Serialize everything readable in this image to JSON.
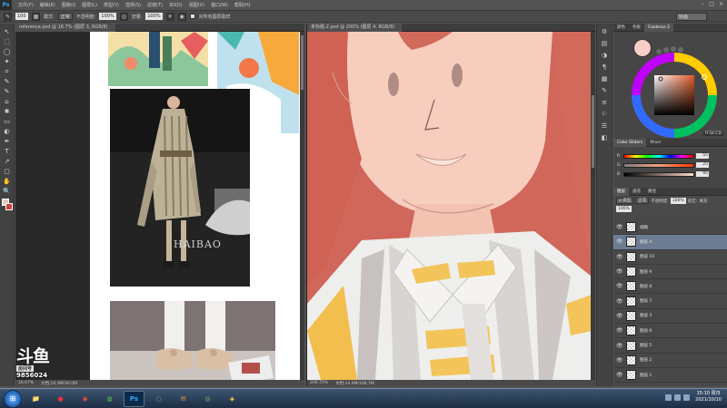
{
  "app": {
    "logo": "Ps"
  },
  "menus": [
    "文件(F)",
    "编辑(E)",
    "图像(I)",
    "图层(L)",
    "类型(Y)",
    "选择(S)",
    "滤镜(T)",
    "3D(D)",
    "视图(V)",
    "窗口(W)",
    "帮助(H)"
  ],
  "window_controls": [
    "–",
    "□",
    "×"
  ],
  "options": {
    "brush_size": "100",
    "mode_label": "模式:",
    "mode_value": "正常",
    "opacity_label": "不透明度:",
    "opacity_value": "100%",
    "flow_label": "流量:",
    "flow_value": "100%",
    "sample_label": "对所有图层取样",
    "workspace": "绘画"
  },
  "tools": [
    "↖",
    "⬚",
    "◯",
    "✦",
    "⌗",
    "✎",
    "✎",
    "⌂",
    "✱",
    "▭",
    "◐",
    "✒",
    "T",
    "↗",
    "▢",
    "✋",
    "🔍"
  ],
  "colors": {
    "foreground": "#e9c7bf",
    "background": "#c9463a",
    "accent": "#31a8ff"
  },
  "doc1": {
    "tab": "reference.psd @ 16.7% (图层 3, RGB/8)",
    "watermark": "HAIBAO",
    "status_zoom": "16.67%",
    "status_doc": "文档:24.9M/30.0M"
  },
  "doc2": {
    "tab": "未标题-2.psd @ 200% (图层 4, RGB/8)",
    "status_zoom": "200.75%",
    "status_doc": "文档:24.9M/106.7M"
  },
  "dock_icons": [
    "⚙",
    "▤",
    "◑",
    "¶",
    "▦",
    "✎",
    "≡",
    "⚐",
    "☰",
    "◧"
  ],
  "color_panel": {
    "tabs": [
      "颜色",
      "色板",
      "Coolorus 2"
    ],
    "hex": "FFDCCD",
    "slider_tabs": [
      "Color Sliders",
      "Mixer"
    ],
    "sliders": [
      {
        "channel": "R",
        "value": "55"
      },
      {
        "channel": "G",
        "value": "25"
      },
      {
        "channel": "B",
        "value": "95"
      }
    ]
  },
  "layers_panel": {
    "tabs": [
      "图层",
      "通道",
      "路径"
    ],
    "kind_label": "ρ 类型",
    "blend_mode": "正常",
    "opacity_label": "不透明度:",
    "opacity_value": "100%",
    "lock_label": "锁定:",
    "fill_label": "填充:",
    "fill_value": "100%",
    "layers": [
      {
        "name": "线稿",
        "selected": false
      },
      {
        "name": "图层 4",
        "selected": true
      },
      {
        "name": "图层 10",
        "selected": false
      },
      {
        "name": "图层 9",
        "selected": false
      },
      {
        "name": "图层 8",
        "selected": false
      },
      {
        "name": "图层 7",
        "selected": false
      },
      {
        "name": "图层 3",
        "selected": false
      },
      {
        "name": "图层 6",
        "selected": false
      },
      {
        "name": "图层 5",
        "selected": false
      },
      {
        "name": "图层 2",
        "selected": false
      },
      {
        "name": "图层 1",
        "selected": false
      }
    ]
  },
  "stream": {
    "logo": "斗鱼",
    "tag": "房间号",
    "room": "9856024"
  },
  "taskbar": {
    "start": "⊞",
    "apps": [
      "📁",
      "●",
      "◉",
      "◍",
      "Ps",
      "◌",
      "✉",
      "◎",
      "◈"
    ],
    "clock_time": "15:10 周日",
    "clock_date": "2021/10/10"
  }
}
